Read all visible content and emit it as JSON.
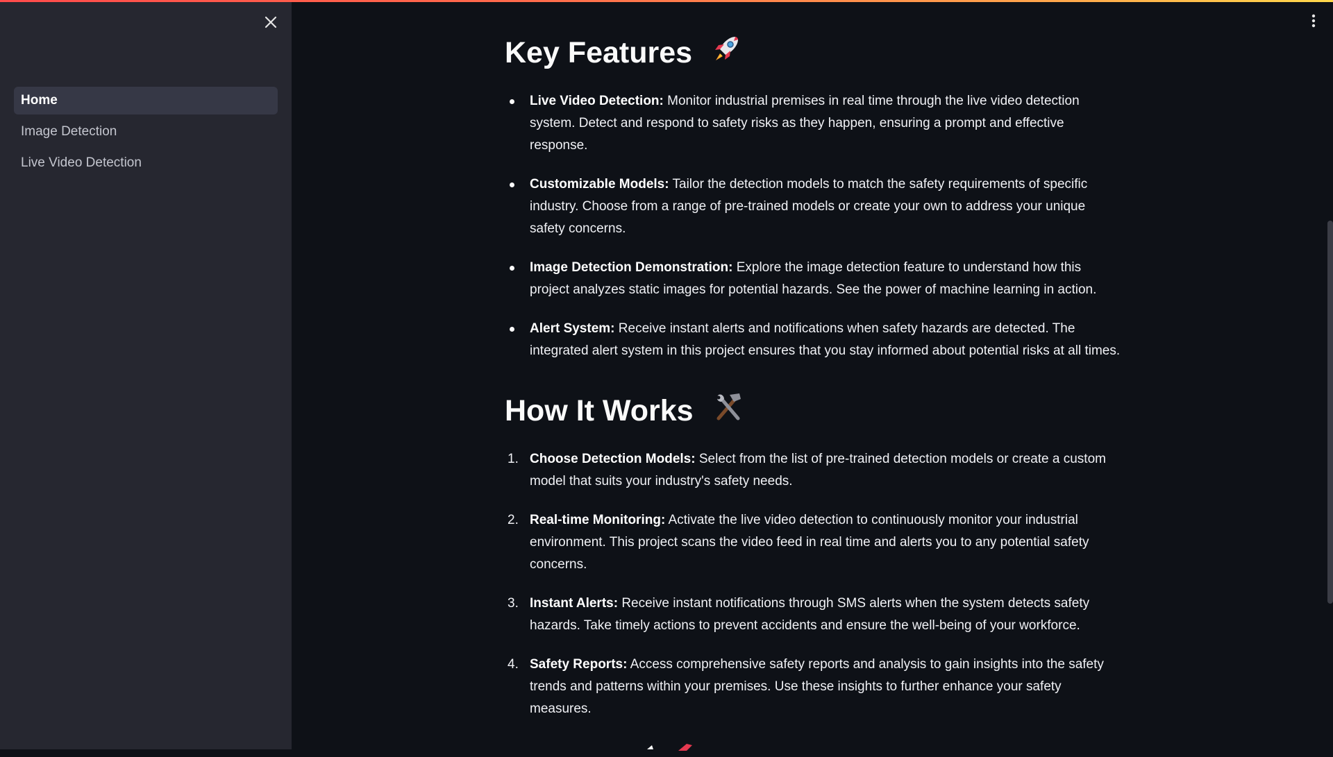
{
  "sidebar": {
    "close_icon": "close-icon",
    "nav": [
      {
        "label": "Home",
        "active": true
      },
      {
        "label": "Image Detection",
        "active": false
      },
      {
        "label": "Live Video Detection",
        "active": false
      }
    ]
  },
  "header": {
    "menu_icon": "vertical-ellipsis-icon"
  },
  "colors": {
    "background": "#0e1117",
    "sidebar": "#262730",
    "active_nav": "#363846",
    "accent_gradient_start": "#ff4b4b",
    "accent_gradient_end": "#ffd84b"
  },
  "main": {
    "key_features": {
      "title": "Key Features",
      "icon": "rocket-emoji",
      "items": [
        {
          "label": "Live Video Detection:",
          "text": "Monitor industrial premises in real time through the live video detection system. Detect and respond to safety risks as they happen, ensuring a prompt and effective response."
        },
        {
          "label": "Customizable Models:",
          "text": "Tailor the detection models to match the safety requirements of specific industry. Choose from a range of pre-trained models or create your own to address your unique safety concerns."
        },
        {
          "label": "Image Detection Demonstration:",
          "text": "Explore the image detection feature to understand how this project analyzes static images for potential hazards. See the power of machine learning in action."
        },
        {
          "label": "Alert System:",
          "text": "Receive instant alerts and notifications when safety hazards are detected. The integrated alert system in this project ensures that you stay informed about potential risks at all times."
        }
      ]
    },
    "how_it_works": {
      "title": "How It Works",
      "icon": "hammer-and-wrench-emoji",
      "items": [
        {
          "num": "1.",
          "label": "Choose Detection Models:",
          "text": "Select from the list of pre-trained detection models or create a custom model that suits your industry's safety needs."
        },
        {
          "num": "2.",
          "label": "Real-time Monitoring:",
          "text": "Activate the live video detection to continuously monitor your industrial environment. This project scans the video feed in real time and alerts you to any potential safety concerns."
        },
        {
          "num": "3.",
          "label": "Instant Alerts:",
          "text": "Receive instant notifications through SMS alerts when the system detects safety hazards. Take timely actions to prevent accidents and ensure the well-being of your workforce."
        },
        {
          "num": "4.",
          "label": "Safety Reports:",
          "text": "Access comprehensive safety reports and analysis to gain insights into the safety trends and patterns within your premises. Use these insights to further enhance your safety measures."
        }
      ]
    }
  }
}
